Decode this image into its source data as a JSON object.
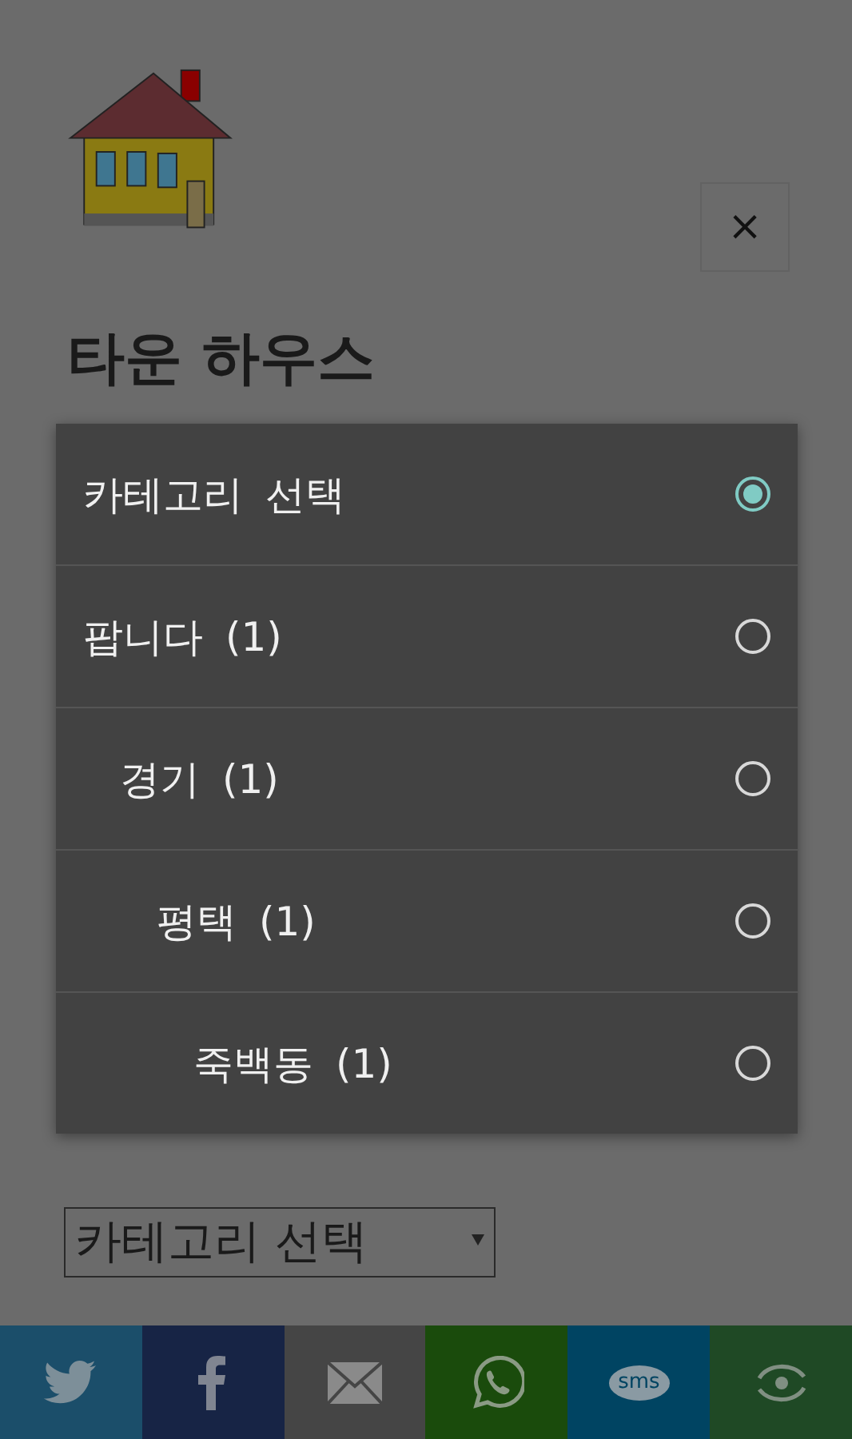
{
  "page": {
    "title": "타운 하우스",
    "close_label": "×",
    "category_select": {
      "value": "카테고리 선택"
    }
  },
  "dialog": {
    "options": [
      {
        "label": "카테고리 선택",
        "selected": true
      },
      {
        "label": "팝니다 (1)",
        "selected": false,
        "children": [
          {
            "label": "경기 (1)",
            "selected": false,
            "children": [
              {
                "label": "평택 (1)",
                "selected": false,
                "children": [
                  {
                    "label": "죽백동 (1)",
                    "selected": false
                  }
                ]
              }
            ]
          }
        ]
      }
    ]
  },
  "share_bar": [
    {
      "kind": "twitter",
      "color": "#1b4e6a"
    },
    {
      "kind": "facebook",
      "color": "#172445"
    },
    {
      "kind": "mail",
      "color": "#454545"
    },
    {
      "kind": "whatsapp",
      "color": "#1a4b0c"
    },
    {
      "kind": "sms",
      "color": "#004462",
      "text": "sms"
    },
    {
      "kind": "share",
      "color": "#1f4925"
    }
  ]
}
